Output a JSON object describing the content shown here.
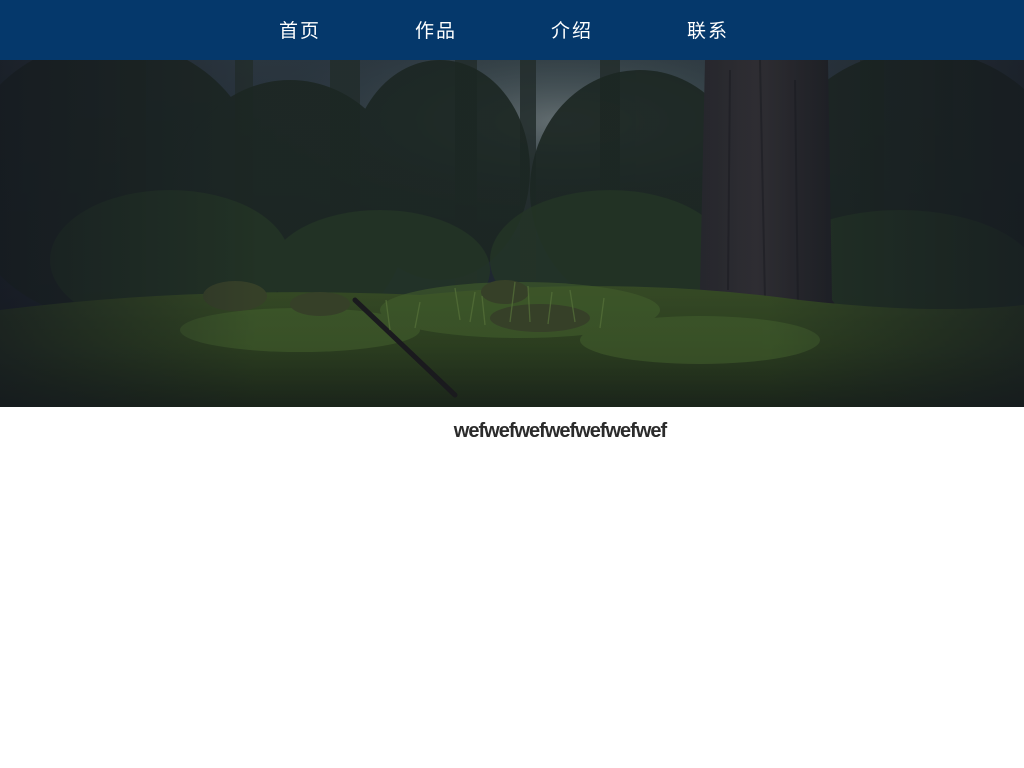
{
  "nav": {
    "items": [
      {
        "label": "首页"
      },
      {
        "label": "作品"
      },
      {
        "label": "介绍"
      },
      {
        "label": "联系"
      }
    ],
    "background": "#05386b",
    "text_color": "#ffffff"
  },
  "hero": {
    "image": "forest-floor-image"
  },
  "main": {
    "heading": "wefwefwefwefwefwefwef",
    "text_color": "#2b2b2b"
  }
}
